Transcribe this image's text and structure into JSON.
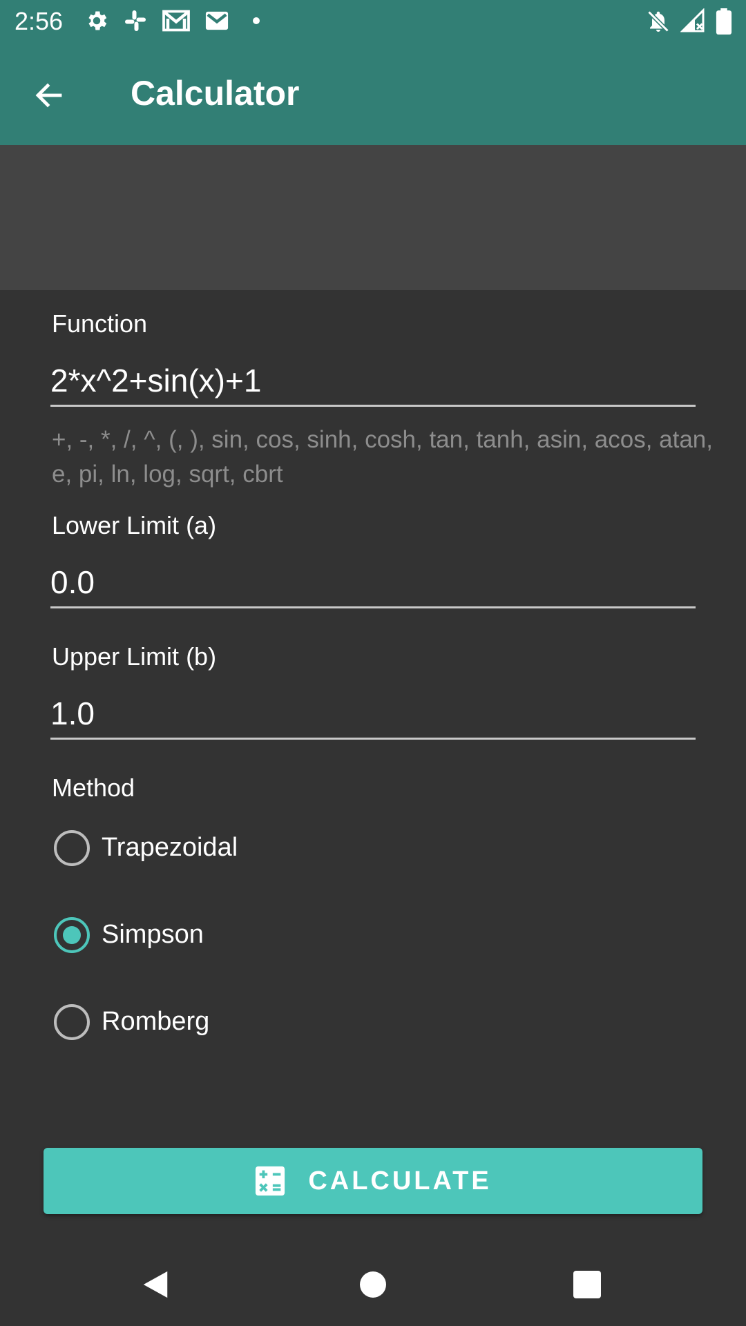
{
  "status_bar": {
    "time": "2:56",
    "icons_left": [
      "settings-icon",
      "slack-icon",
      "gmail-icon",
      "gmail-icon",
      "dot-icon"
    ],
    "icons_right": [
      "notifications-off-icon",
      "signal-icon",
      "battery-icon"
    ]
  },
  "app_bar": {
    "title": "Calculator",
    "back_icon": "arrow-back-icon",
    "color": "#327f75"
  },
  "form": {
    "function": {
      "label": "Function",
      "value": "2*x^2+sin(x)+1",
      "hint": "+, -, *, /, ^, (, ), sin, cos, sinh, cosh, tan, tanh, asin, acos, atan, e, pi, ln, log, sqrt, cbrt"
    },
    "lower": {
      "label": "Lower Limit (a)",
      "value": "0.0"
    },
    "upper": {
      "label": "Upper Limit (b)",
      "value": "1.0"
    },
    "method": {
      "label": "Method",
      "options": [
        "Trapezoidal",
        "Simpson",
        "Romberg"
      ],
      "selected": "Simpson"
    }
  },
  "calculate_button": {
    "label": "CALCULATE",
    "icon": "calculator-icon",
    "color": "#4dc6ba"
  },
  "nav_bar": {
    "icons": [
      "back-triangle-icon",
      "home-circle-icon",
      "recents-square-icon"
    ]
  }
}
